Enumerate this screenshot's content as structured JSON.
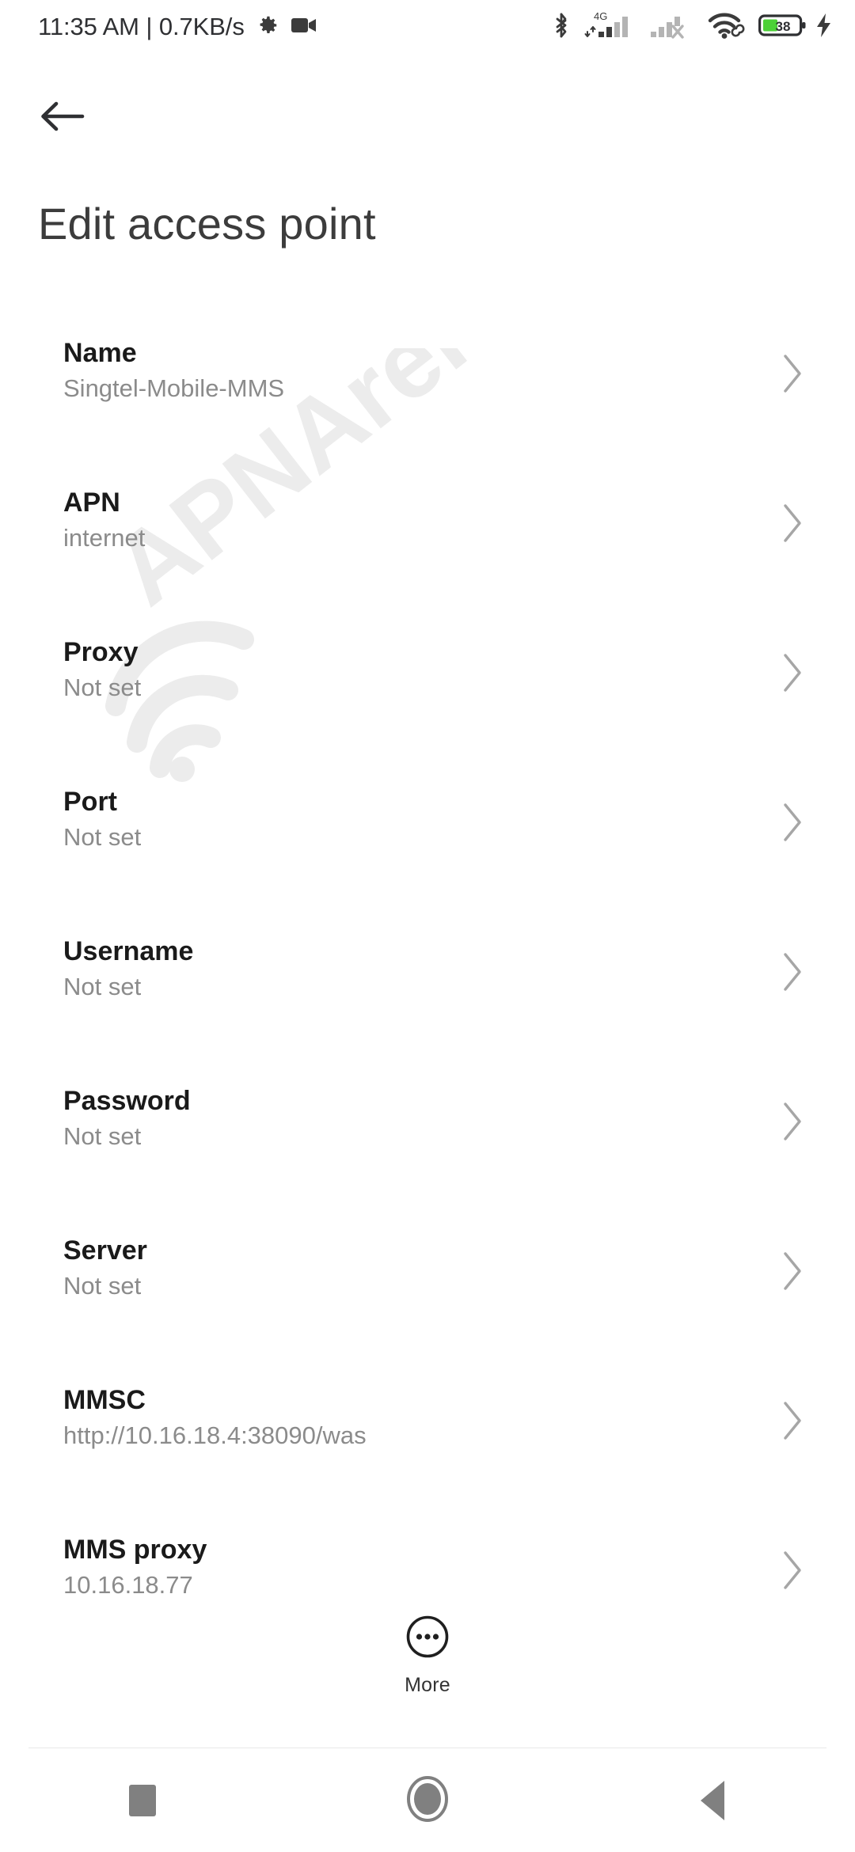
{
  "status_bar": {
    "clock_and_net": "11:35 AM | 0.7KB/s",
    "left_icons": [
      "gear-icon",
      "video-camera-icon"
    ],
    "right_icons": [
      "bluetooth-icon",
      "signal-4g-icon",
      "signal-sim2-no-service-icon",
      "wifi-icon",
      "battery-icon",
      "charging-bolt-icon"
    ],
    "network_type": "4G",
    "battery_percent": "38",
    "battery_color": "#4cd137",
    "icon_color": "#3b3b3b"
  },
  "header": {
    "back_icon": "arrow-left-icon",
    "title": "Edit access point"
  },
  "watermark": {
    "text": "APNArena",
    "color": "#ececec"
  },
  "settings": {
    "rows": [
      {
        "label": "Name",
        "value": "Singtel-Mobile-MMS"
      },
      {
        "label": "APN",
        "value": "internet"
      },
      {
        "label": "Proxy",
        "value": "Not set"
      },
      {
        "label": "Port",
        "value": "Not set"
      },
      {
        "label": "Username",
        "value": "Not set"
      },
      {
        "label": "Password",
        "value": "Not set"
      },
      {
        "label": "Server",
        "value": "Not set"
      },
      {
        "label": "MMSC",
        "value": "http://10.16.18.4:38090/was"
      },
      {
        "label": "MMS proxy",
        "value": "10.16.18.77"
      }
    ]
  },
  "more_button": {
    "label": "More",
    "icon": "more-circle-icon"
  },
  "navbar": {
    "recents_label": "recents",
    "home_label": "home",
    "back_label": "back",
    "color": "#808080"
  }
}
